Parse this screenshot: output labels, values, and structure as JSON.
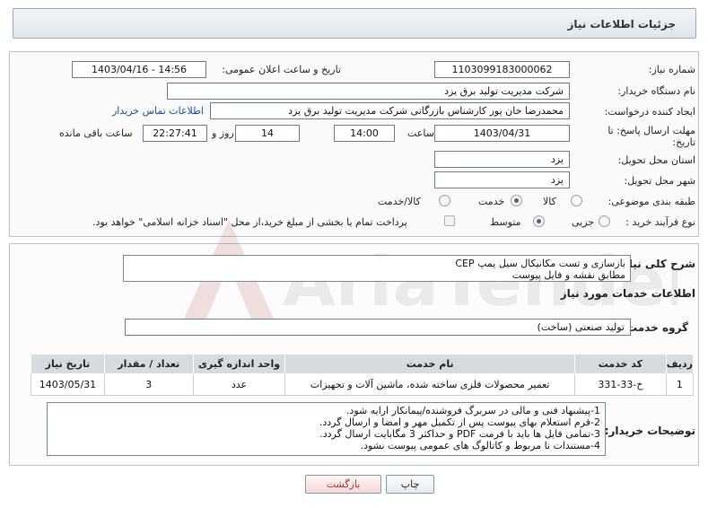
{
  "header": {
    "title": "جزئیات اطلاعات نیاز"
  },
  "form": {
    "need_number_label": "شماره نیاز:",
    "need_number": "1103099183000062",
    "announce_label": "تاریخ و ساعت اعلان عمومی:",
    "announce_value": "1403/04/16 - 14:56",
    "buyer_org_label": "نام دستگاه خریدار:",
    "buyer_org": "شرکت مدیریت تولید برق یزد",
    "creator_label": "ایجاد کننده درخواست:",
    "creator": "محمدرضا خان پور کارشناس بازرگانی شرکت مدیریت تولید برق یزد",
    "contact_link": "اطلاعات تماس خریدار",
    "deadline_label_1": "مهلت ارسال پاسخ: تا",
    "deadline_label_2": "تاریخ:",
    "deadline_date": "1403/04/31",
    "time_label": "ساعت",
    "deadline_time": "14:00",
    "days_value": "14",
    "days_label": "روز و",
    "remaining_time": "22:27:41",
    "remaining_label": "ساعت باقی مانده",
    "province_label": "استان محل تحویل:",
    "province": "یزد",
    "city_label": "شهر محل تحویل:",
    "city": "یزد",
    "category_label": "طبقه بندی موضوعی:",
    "category_options": [
      "کالا",
      "خدمت",
      "کالا/خدمت"
    ],
    "category_selected": "خدمت",
    "process_label": "نوع فرآیند خرید :",
    "process_options": [
      "جزیی",
      "متوسط"
    ],
    "process_selected": "متوسط",
    "payment_note": "پرداخت تمام یا بخشی از مبلغ خرید،از محل \"اسناد خزانه اسلامی\" خواهد بود."
  },
  "details": {
    "summary_label": "شرح کلی نیاز:",
    "summary": "بازسازی و تست مکانیکال سیل پمپ CEP\nمطابق نقشه و فایل پیوست",
    "services_title": "اطلاعات خدمات مورد نیاز",
    "service_group_label": "گروه خدمت:",
    "service_group": "تولید صنعتی (ساخت)",
    "table": {
      "headers": [
        "ردیف",
        "کد خدمت",
        "نام خدمت",
        "واحد اندازه گیری",
        "تعداد / مقدار",
        "تاریخ نیاز"
      ],
      "rows": [
        [
          "1",
          "خ-33-331",
          "تعمیر محصولات فلزی ساخته شده، ماشین آلات و تجهیزات",
          "عدد",
          "3",
          "1403/05/31"
        ]
      ]
    },
    "buyer_notes_label": "توضیحات خریدار:",
    "buyer_notes": "1-پیشنهاد فنی و مالی در سربرگ فروشنده/پیمانکار ارایه شود.\n2-فرم استعلام بهای پیوست پس از تکمیل مهر و امضا و ارسال گردد.\n3-تمامی فایل ها باید با فرمت PDF و حداکثر 3 مگابایت ارسال گردد.\n4-مستندات نا مربوط و کاتالوگ های عمومی پیوست نشود."
  },
  "buttons": {
    "print": "چاپ",
    "back": "بازگشت"
  },
  "watermark": {
    "text": "AriaTender.net"
  },
  "colors": {
    "link": "#1a4fa0",
    "back_button_text": "#a33333",
    "header_bg": "#dfe5ec"
  }
}
